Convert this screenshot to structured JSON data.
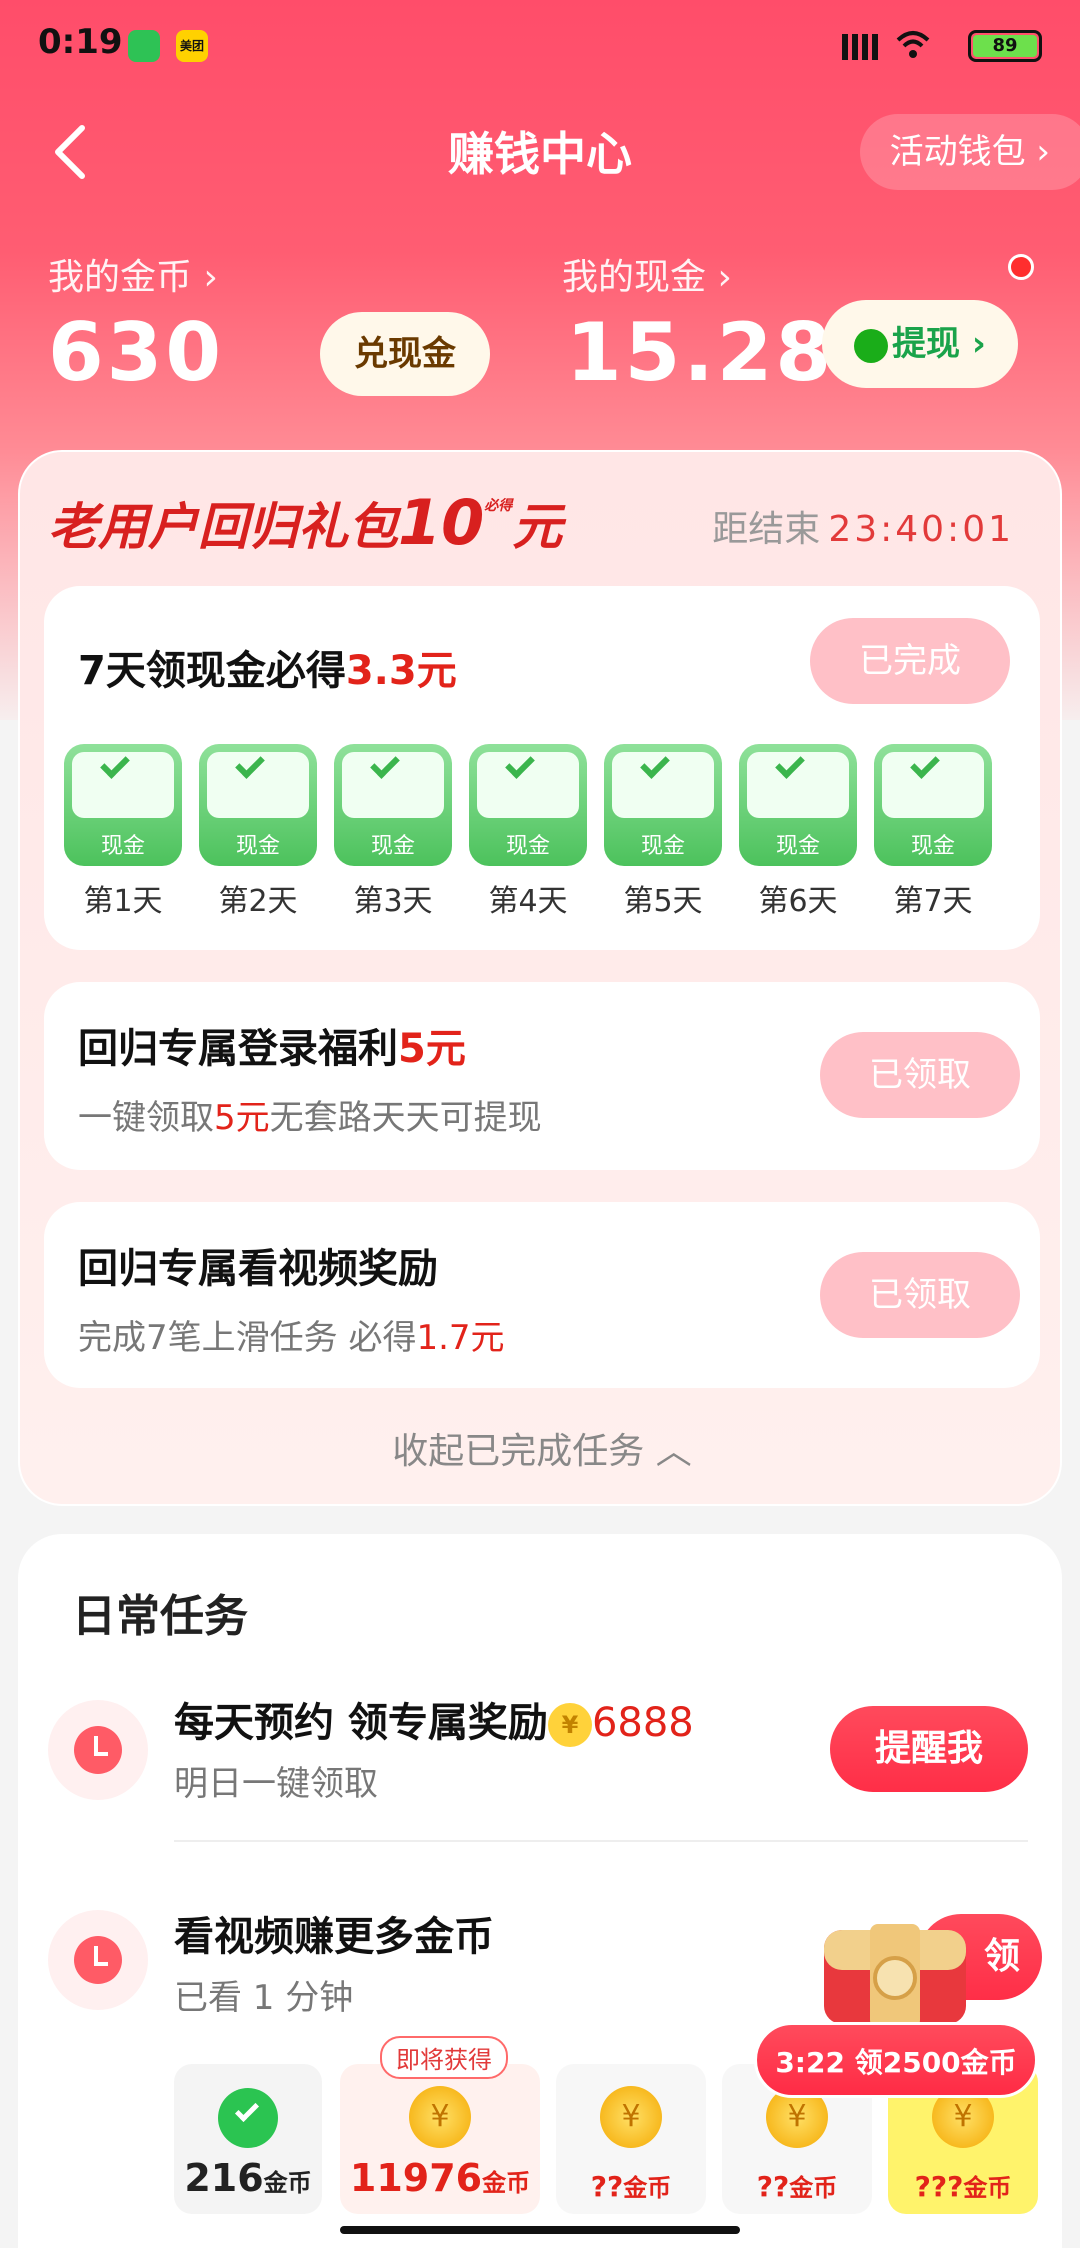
{
  "status_bar": {
    "time": "0:19",
    "app_badge_2": "美团",
    "battery": "89"
  },
  "header": {
    "title": "赚钱中心",
    "wallet_label": "活动钱包"
  },
  "balance": {
    "coins_label": "我的金币",
    "coins_value": "630",
    "exchange_label": "兑现金",
    "cash_label": "我的现金",
    "cash_value": "15.28",
    "withdraw_label": "提现"
  },
  "return_card": {
    "title_prefix": "老用户回归礼包",
    "title_amount": "10",
    "title_must": "必得",
    "title_unit": "元",
    "countdown_label": "距结束",
    "countdown_value": "23:40:01",
    "checkin": {
      "title_prefix": "7天领现金必得",
      "title_amount": "3.3元",
      "button": "已完成",
      "reward_label": "现金",
      "days": [
        "第1天",
        "第2天",
        "第3天",
        "第4天",
        "第5天",
        "第6天",
        "第7天"
      ]
    },
    "login": {
      "title_prefix": "回归专属登录福利",
      "title_amount": "5元",
      "sub_prefix": "一键领取",
      "sub_amount": "5元",
      "sub_suffix": "无套路天天可提现",
      "button": "已领取"
    },
    "video": {
      "title": "回归专属看视频奖励",
      "sub_prefix": "完成7笔上滑任务 必得",
      "sub_amount": "1.7元",
      "button": "已领取"
    },
    "collapse_label": "收起已完成任务"
  },
  "daily": {
    "title": "日常任务",
    "task1": {
      "title": "每天预约 领专属奖励",
      "reward": "6888",
      "sub": "明日一键领取",
      "button": "提醒我"
    },
    "task2": {
      "title": "看视频赚更多金币",
      "sub": "已看 1 分钟",
      "button_partial": "领"
    },
    "strip": [
      {
        "value": "216",
        "unit": "金币",
        "tag": ""
      },
      {
        "value": "11976",
        "unit": "金币",
        "tag": "即将获得"
      },
      {
        "value": "??",
        "unit": "金币",
        "tag": ""
      },
      {
        "value": "??",
        "unit": "金币",
        "tag": ""
      },
      {
        "value": "???",
        "unit": "金币",
        "tag": ""
      }
    ]
  },
  "floating": {
    "timer": "3:22",
    "text": "领2500金币"
  },
  "colors": {
    "primary": "#ff3b52",
    "checkin_green": "#4cc25c",
    "amount_red": "#e2231a"
  }
}
